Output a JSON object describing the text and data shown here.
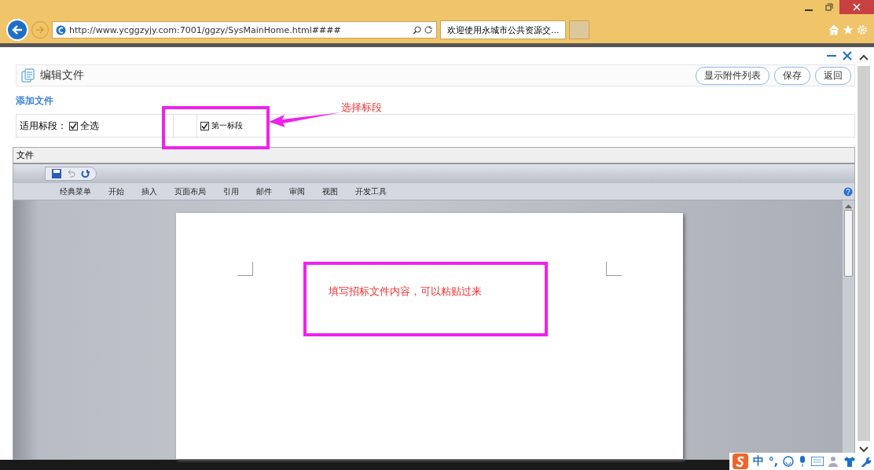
{
  "browser": {
    "url": "http://www.ycggzyjy.com:7001/ggzy/SysMainHome.html####",
    "tab_title": "欢迎使用永城市公共资源交..."
  },
  "page": {
    "title": "编辑文件",
    "buttons": [
      "显示附件列表",
      "保存",
      "返回"
    ],
    "section": "添加文件",
    "segment_label": "适用标段：",
    "select_all": {
      "label": "全选",
      "checked": true
    },
    "segments": [
      {
        "label": "第一标段",
        "checked": true
      }
    ]
  },
  "document": {
    "title": "文件",
    "ribbon_tabs": [
      "经典菜单",
      "开始",
      "插入",
      "页面布局",
      "引用",
      "邮件",
      "审阅",
      "视图",
      "开发工具"
    ]
  },
  "annotations": [
    {
      "kind": "arrow",
      "text": "选择标段"
    },
    {
      "kind": "box",
      "text": "填写招标文件内容，可以粘贴过来"
    }
  ],
  "ime": {
    "mode": "中",
    "punct": "°,"
  }
}
